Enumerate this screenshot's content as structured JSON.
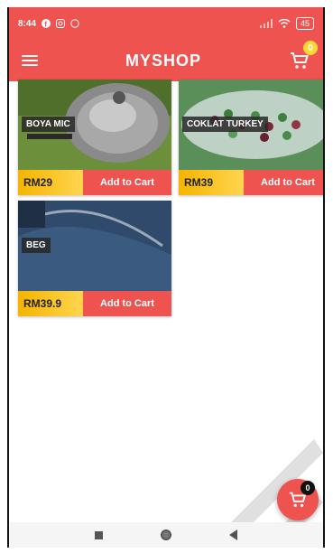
{
  "status_bar": {
    "time": "8:44",
    "battery": "45"
  },
  "app_bar": {
    "title": "MYSHOP",
    "cart_count": "0"
  },
  "products": [
    {
      "name": "BOYA MIC",
      "price": "RM29",
      "action": "Add to Cart"
    },
    {
      "name": "COKLAT TURKEY",
      "price": "RM39",
      "action": "Add to Cart"
    },
    {
      "name": "BEG",
      "price": "RM39.9",
      "action": "Add to Cart"
    }
  ],
  "fab": {
    "cart_count": "0"
  },
  "colors": {
    "primary": "#ef5350",
    "price_bg": "#f5b400",
    "badge": "#fdd835"
  }
}
